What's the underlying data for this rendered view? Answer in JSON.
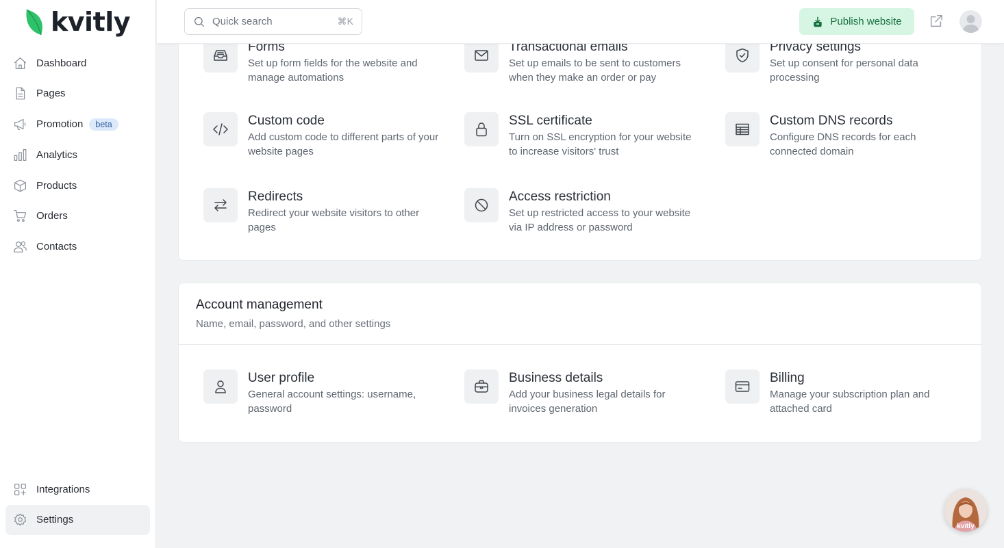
{
  "brand": {
    "name": "kvitly",
    "accent": "#22c55e",
    "publish_bg": "#d6f5e3",
    "publish_text": "#17703f"
  },
  "sidebar": {
    "items": [
      {
        "label": "Dashboard",
        "icon": "home-icon"
      },
      {
        "label": "Pages",
        "icon": "page-icon"
      },
      {
        "label": "Promotion",
        "icon": "megaphone-icon",
        "badge": "beta"
      },
      {
        "label": "Analytics",
        "icon": "bar-chart-icon"
      },
      {
        "label": "Products",
        "icon": "box-icon"
      },
      {
        "label": "Orders",
        "icon": "cart-icon"
      },
      {
        "label": "Contacts",
        "icon": "users-icon"
      }
    ],
    "bottom_items": [
      {
        "label": "Integrations",
        "icon": "grid-plus-icon"
      },
      {
        "label": "Settings",
        "icon": "gear-icon",
        "active": true
      }
    ]
  },
  "topbar": {
    "search": {
      "placeholder": "Quick search",
      "shortcut": "⌘K"
    },
    "publish_label": "Publish website"
  },
  "website_settings": {
    "items": [
      {
        "title": "Forms",
        "desc": "Set up form fields for the website and manage automations",
        "icon": "inbox-icon"
      },
      {
        "title": "Transactional emails",
        "desc": "Set up emails to be sent to customers when they make an order or pay",
        "icon": "mail-icon"
      },
      {
        "title": "Privacy settings",
        "desc": "Set up consent for personal data processing",
        "icon": "shield-check-icon"
      },
      {
        "title": "Custom code",
        "desc": "Add custom code to different parts of your website pages",
        "icon": "code-icon"
      },
      {
        "title": "SSL certificate",
        "desc": "Turn on SSL encryption for your website to increase visitors' trust",
        "icon": "lock-icon"
      },
      {
        "title": "Custom DNS records",
        "desc": "Configure DNS records for each connected domain",
        "icon": "table-icon"
      },
      {
        "title": "Redirects",
        "desc": "Redirect your website visitors to other pages",
        "icon": "arrows-swap-icon"
      },
      {
        "title": "Access restriction",
        "desc": "Set up restricted access to your website via IP address or password",
        "icon": "ban-icon"
      }
    ]
  },
  "account_management": {
    "title": "Account management",
    "subtitle": "Name, email, password, and other settings",
    "items": [
      {
        "title": "User profile",
        "desc": "General account settings: username, password",
        "icon": "user-icon"
      },
      {
        "title": "Business details",
        "desc": "Add your business legal details for invoices generation",
        "icon": "briefcase-icon"
      },
      {
        "title": "Billing",
        "desc": "Manage your subscription plan and attached card",
        "icon": "credit-card-icon"
      }
    ]
  },
  "chat_widget": {
    "label": "kvitly"
  }
}
